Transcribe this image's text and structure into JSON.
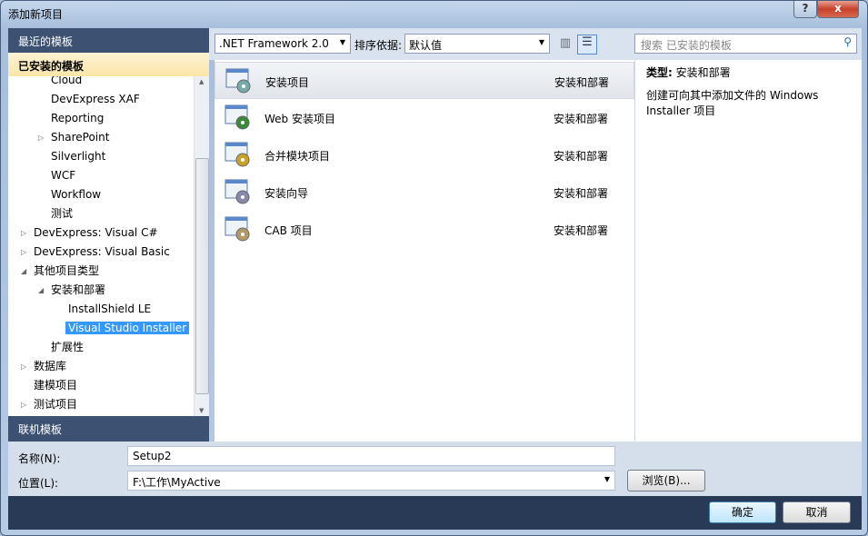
{
  "window": {
    "title": "添加新项目",
    "help": "?",
    "close": "x"
  },
  "left": {
    "recent": "最近的模板",
    "installed": "已安装的模板",
    "online": "联机模板",
    "tree": [
      {
        "label": "Cloud",
        "level": 2,
        "arrow": ""
      },
      {
        "label": "DevExpress XAF",
        "level": 2,
        "arrow": ""
      },
      {
        "label": "Reporting",
        "level": 2,
        "arrow": ""
      },
      {
        "label": "SharePoint",
        "level": 2,
        "arrow": "collapsed"
      },
      {
        "label": "Silverlight",
        "level": 2,
        "arrow": ""
      },
      {
        "label": "WCF",
        "level": 2,
        "arrow": ""
      },
      {
        "label": "Workflow",
        "level": 2,
        "arrow": ""
      },
      {
        "label": "测试",
        "level": 2,
        "arrow": ""
      },
      {
        "label": "DevExpress: Visual C#",
        "level": 1,
        "arrow": "collapsed"
      },
      {
        "label": "DevExpress: Visual Basic",
        "level": 1,
        "arrow": "collapsed"
      },
      {
        "label": "其他项目类型",
        "level": 1,
        "arrow": "expanded"
      },
      {
        "label": "安装和部署",
        "level": 2,
        "arrow": "expanded"
      },
      {
        "label": "InstallShield LE",
        "level": 3,
        "arrow": ""
      },
      {
        "label": "Visual Studio Installer",
        "level": 3,
        "arrow": "",
        "selected": true
      },
      {
        "label": "扩展性",
        "level": 2,
        "arrow": ""
      },
      {
        "label": "数据库",
        "level": 1,
        "arrow": "collapsed"
      },
      {
        "label": "建模项目",
        "level": 1,
        "arrow": ""
      },
      {
        "label": "测试项目",
        "level": 1,
        "arrow": "collapsed"
      }
    ]
  },
  "toolbar": {
    "framework": ".NET Framework 2.0",
    "sort_label": "排序依据:",
    "sort_value": "默认值",
    "search_placeholder": "搜索 已安装的模板"
  },
  "templates": [
    {
      "name": "安装项目",
      "category": "安装和部署",
      "icon": "setup-project-icon",
      "selected": true
    },
    {
      "name": "Web 安装项目",
      "category": "安装和部署",
      "icon": "web-setup-icon"
    },
    {
      "name": "合并模块项目",
      "category": "安装和部署",
      "icon": "merge-module-icon"
    },
    {
      "name": "安装向导",
      "category": "安装和部署",
      "icon": "setup-wizard-icon"
    },
    {
      "name": "CAB 项目",
      "category": "安装和部署",
      "icon": "cab-project-icon"
    }
  ],
  "details": {
    "type_label": "类型:",
    "type_value": "安装和部署",
    "description": "创建可向其中添加文件的 Windows Installer 项目"
  },
  "form": {
    "name_label": "名称(N):",
    "name_value": "Setup2",
    "location_label": "位置(L):",
    "location_value": "F:\\工作\\MyActive",
    "browse": "浏览(B)..."
  },
  "buttons": {
    "ok": "确定",
    "cancel": "取消"
  }
}
